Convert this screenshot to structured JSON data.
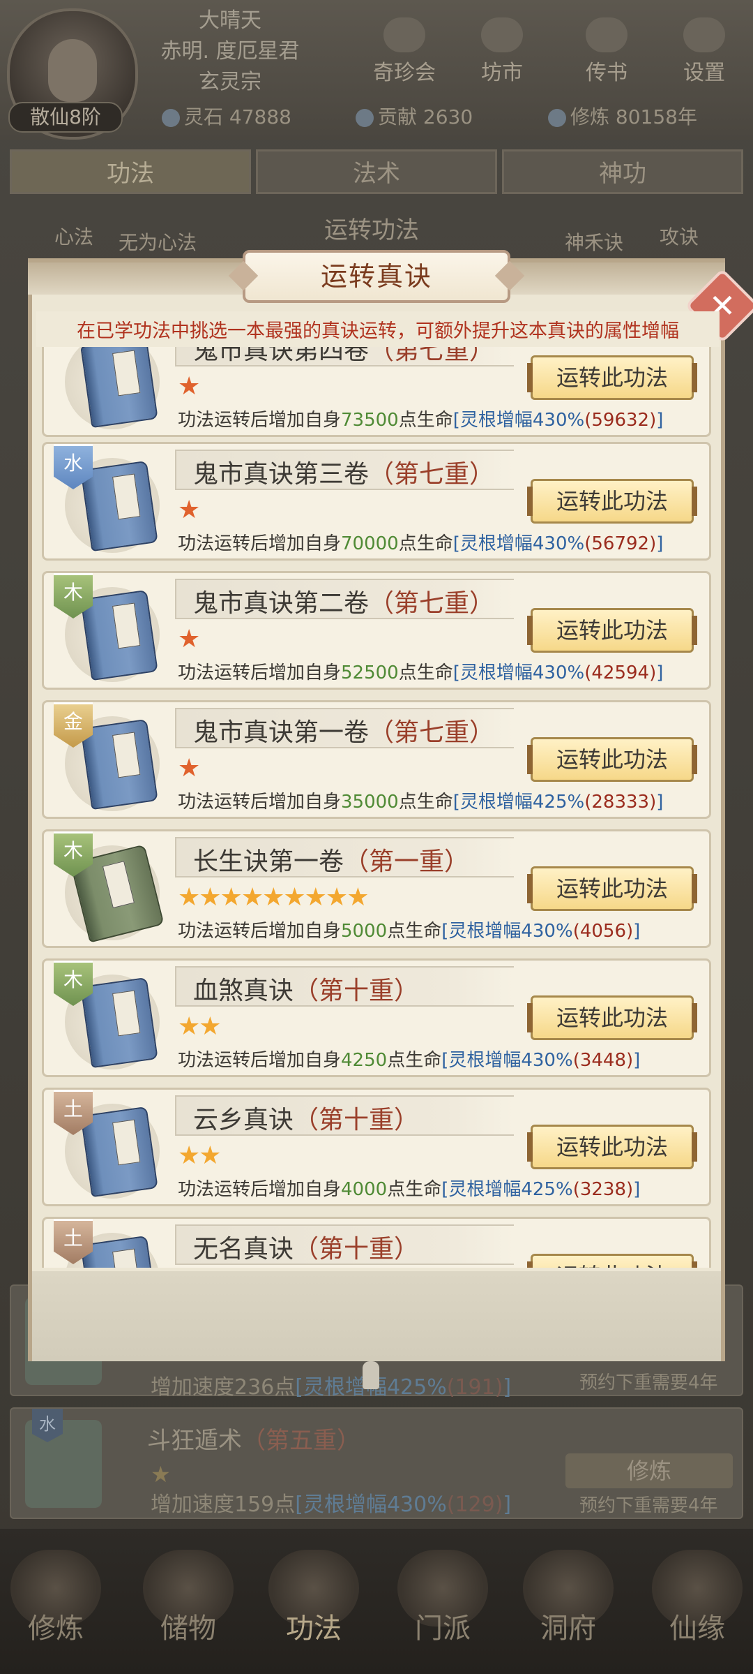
{
  "header": {
    "rank": "散仙8阶",
    "weather": "大晴天",
    "titles": [
      "赤明. 度厄星君",
      "玄灵宗"
    ],
    "top_buttons": [
      "奇珍会",
      "坊市",
      "传书",
      "设置"
    ],
    "resources": {
      "lingshi_label": "灵石",
      "lingshi": "47888",
      "gongxian_label": "贡献",
      "gongxian": "2630",
      "xiulian_label": "修炼",
      "xiulian": "80158年"
    }
  },
  "tabs": [
    "功法",
    "法术",
    "神功"
  ],
  "sub_row": {
    "left1": "心法",
    "left2": "无为心法",
    "center": "运转功法",
    "right1": "神禾诀",
    "right2": "攻诀"
  },
  "modal": {
    "title": "运转真诀",
    "description": "在已学功法中挑选一本最强的真诀运转，可额外提升这本真诀的属性增幅",
    "close_icon": "close-icon",
    "items": [
      {
        "element": "",
        "title": "鬼市真诀第四卷",
        "level": "（第七重）",
        "stars": "★",
        "stat_prefix": "功法运转后增加自身",
        "num": "73500",
        "stat_mid": "点生命",
        "pct": "[灵根增幅430%",
        "val": "(59632)",
        "close": "]",
        "button": "运转此功法"
      },
      {
        "element": "水",
        "title": "鬼市真诀第三卷",
        "level": "（第七重）",
        "stars": "★",
        "stat_prefix": "功法运转后增加自身",
        "num": "70000",
        "stat_mid": "点生命",
        "pct": "[灵根增幅430%",
        "val": "(56792)",
        "close": "]",
        "button": "运转此功法"
      },
      {
        "element": "木",
        "title": "鬼市真诀第二卷",
        "level": "（第七重）",
        "stars": "★",
        "stat_prefix": "功法运转后增加自身",
        "num": "52500",
        "stat_mid": "点生命",
        "pct": "[灵根增幅430%",
        "val": "(42594)",
        "close": "]",
        "button": "运转此功法"
      },
      {
        "element": "金",
        "title": "鬼市真诀第一卷",
        "level": "（第七重）",
        "stars": "★",
        "stat_prefix": "功法运转后增加自身",
        "num": "35000",
        "stat_mid": "点生命",
        "pct": "[灵根增幅425%",
        "val": "(28333)",
        "close": "]",
        "button": "运转此功法"
      },
      {
        "element": "木",
        "title": "长生诀第一卷",
        "level": "（第一重）",
        "stars": "★★★★★★★★★",
        "stat_prefix": "功法运转后增加自身",
        "num": "5000",
        "stat_mid": "点生命",
        "pct": "[灵根增幅430%",
        "val": "(4056)",
        "close": "]",
        "button": "运转此功法"
      },
      {
        "element": "木",
        "title": "血煞真诀",
        "level": "（第十重）",
        "stars": "★★",
        "stat_prefix": "功法运转后增加自身",
        "num": "4250",
        "stat_mid": "点生命",
        "pct": "[灵根增幅430%",
        "val": "(3448)",
        "close": "]",
        "button": "运转此功法"
      },
      {
        "element": "土",
        "title": "云乡真诀",
        "level": "（第十重）",
        "stars": "★★",
        "stat_prefix": "功法运转后增加自身",
        "num": "4000",
        "stat_mid": "点生命",
        "pct": "[灵根增幅425%",
        "val": "(3238)",
        "close": "]",
        "button": "运转此功法"
      },
      {
        "element": "土",
        "title": "无名真诀",
        "level": "（第十重）",
        "stars": "",
        "stat_prefix": "",
        "num": "",
        "stat_mid": "",
        "pct": "",
        "val": "",
        "close": "",
        "button": "运转此功法"
      }
    ]
  },
  "lower_list": [
    {
      "element": "",
      "title": "",
      "level": "",
      "stars": "",
      "stat": "增加速度236点",
      "pct": "[灵根增幅425%",
      "val": "(191)",
      "close": "]",
      "button": "",
      "note": "预约下重需要4年"
    },
    {
      "element": "水",
      "title": "斗狂遁术",
      "level": "（第五重）",
      "stars": "★",
      "stat": "增加速度159点",
      "pct": "[灵根增幅430%",
      "val": "(129)",
      "close": "]",
      "button": "修炼",
      "note": "预约下重需要4年"
    }
  ],
  "bottom_nav": [
    "修炼",
    "储物",
    "功法",
    "门派",
    "洞府",
    "仙缘"
  ],
  "colors": {
    "accent_red": "#b0321e",
    "button_gold": "#f6d889",
    "stat_green": "#4f8a35",
    "stat_blue": "#2f62a0"
  }
}
